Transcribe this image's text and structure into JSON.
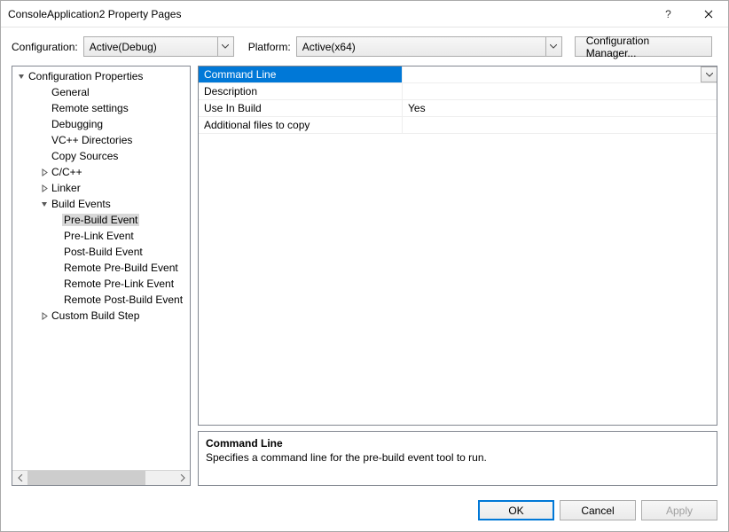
{
  "title": "ConsoleApplication2 Property Pages",
  "toolbar": {
    "configuration_label": "Configuration:",
    "configuration_value": "Active(Debug)",
    "platform_label": "Platform:",
    "platform_value": "Active(x64)",
    "config_manager_label": "Configuration Manager..."
  },
  "tree": {
    "root": "Configuration Properties",
    "items": [
      {
        "label": "General",
        "indent": 2,
        "exp": ""
      },
      {
        "label": "Remote settings",
        "indent": 2,
        "exp": ""
      },
      {
        "label": "Debugging",
        "indent": 2,
        "exp": ""
      },
      {
        "label": "VC++ Directories",
        "indent": 2,
        "exp": ""
      },
      {
        "label": "Copy Sources",
        "indent": 2,
        "exp": ""
      },
      {
        "label": "C/C++",
        "indent": 2,
        "exp": "closed"
      },
      {
        "label": "Linker",
        "indent": 2,
        "exp": "closed"
      },
      {
        "label": "Build Events",
        "indent": 2,
        "exp": "open"
      },
      {
        "label": "Pre-Build Event",
        "indent": 3,
        "exp": "",
        "selected": true
      },
      {
        "label": "Pre-Link Event",
        "indent": 3,
        "exp": ""
      },
      {
        "label": "Post-Build Event",
        "indent": 3,
        "exp": ""
      },
      {
        "label": "Remote Pre-Build Event",
        "indent": 3,
        "exp": ""
      },
      {
        "label": "Remote Pre-Link Event",
        "indent": 3,
        "exp": ""
      },
      {
        "label": "Remote Post-Build Event",
        "indent": 3,
        "exp": ""
      },
      {
        "label": "Custom Build Step",
        "indent": 2,
        "exp": "closed"
      }
    ]
  },
  "grid": {
    "rows": [
      {
        "name": "Command Line",
        "value": "",
        "selected": true,
        "dropdown": true
      },
      {
        "name": "Description",
        "value": ""
      },
      {
        "name": "Use In Build",
        "value": "Yes"
      },
      {
        "name": "Additional files to copy",
        "value": ""
      }
    ]
  },
  "description": {
    "title": "Command Line",
    "text": "Specifies a command line for the pre-build event tool to run."
  },
  "buttons": {
    "ok": "OK",
    "cancel": "Cancel",
    "apply": "Apply"
  }
}
